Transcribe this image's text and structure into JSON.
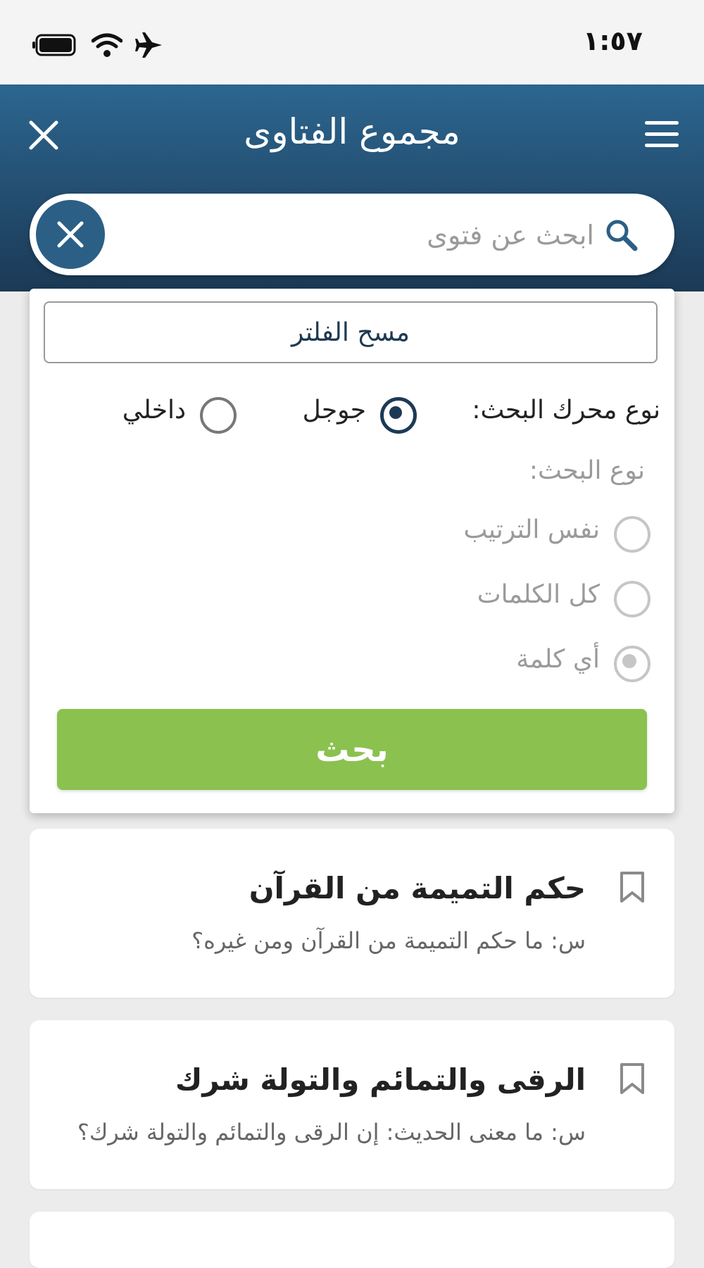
{
  "status_bar": {
    "time": "١:٥٧",
    "icons": [
      "battery-icon",
      "wifi-icon",
      "airplane-icon"
    ]
  },
  "header": {
    "title": "مجموع الفتاوى",
    "icons": [
      "menu-icon",
      "close-icon"
    ]
  },
  "search": {
    "placeholder": "ابحث عن فتوى",
    "value": ""
  },
  "filter": {
    "clear_label": "مسح الفلتر",
    "engine_label": "نوع محرك البحث:",
    "engine_options": [
      {
        "label": "جوجل",
        "selected": true
      },
      {
        "label": "داخلي",
        "selected": false
      }
    ],
    "type_label": "نوع البحث:",
    "type_options": [
      {
        "label": "نفس الترتيب",
        "selected": false
      },
      {
        "label": "كل الكلمات",
        "selected": false
      },
      {
        "label": "أي كلمة",
        "selected": true
      }
    ],
    "submit_label": "بحث"
  },
  "results": [
    {
      "title": "حكم التميمة من القرآن",
      "question": "س: ما حكم التميمة من القرآن ومن غيره؟"
    },
    {
      "title": "الرقى والتمائم والتولة شرك",
      "question": "س: ما معنى الحديث: إن الرقى والتمائم والتولة شرك؟"
    }
  ],
  "colors": {
    "header_top": "#2c6690",
    "header_bottom": "#1b3a56",
    "accent_green": "#8bc14f",
    "radio_dark": "#1c3a56"
  }
}
